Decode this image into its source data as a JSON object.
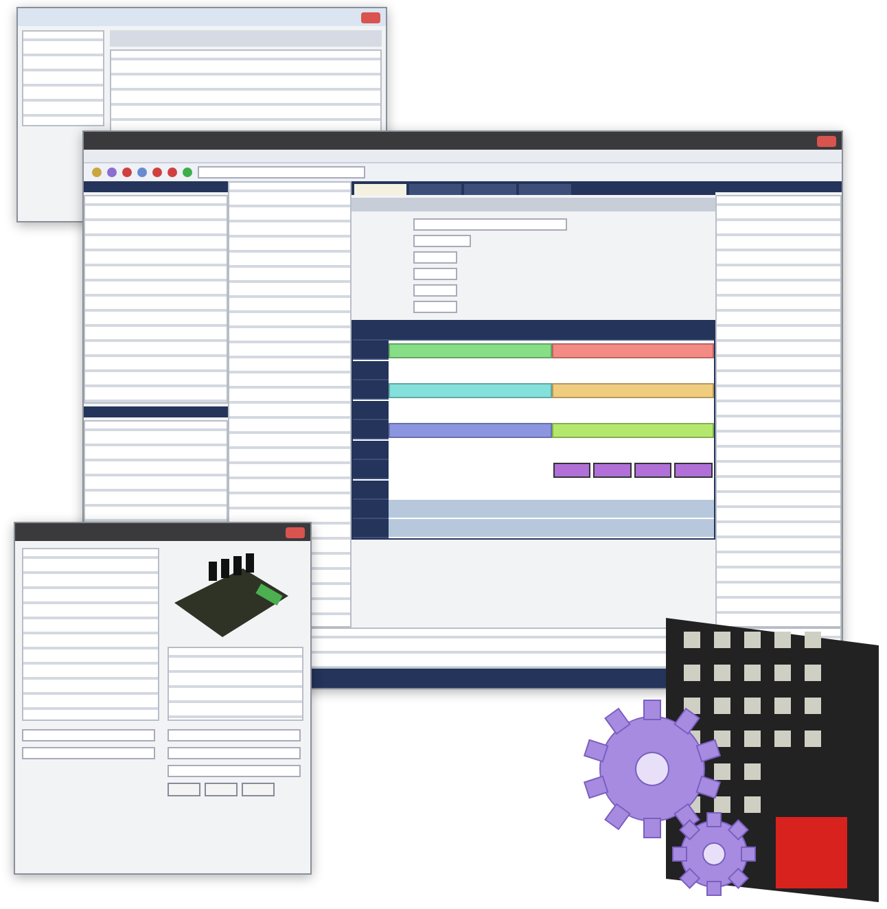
{
  "windows": [
    {
      "kind": "settings"
    },
    {
      "kind": "main"
    },
    {
      "kind": "device-dialog"
    }
  ],
  "main_tabs": [
    {
      "selected": true
    },
    {
      "selected": false
    },
    {
      "selected": false
    },
    {
      "selected": false
    }
  ],
  "schedule": {
    "rows": [
      {
        "kind": "bars",
        "segments": [
          {
            "kind": "bar",
            "color": "#86de86"
          },
          {
            "kind": "bar",
            "color": "#f48a84"
          }
        ]
      },
      {
        "kind": "empty"
      },
      {
        "kind": "bars",
        "segments": [
          {
            "kind": "bar",
            "color": "#84e0da"
          },
          {
            "kind": "bar",
            "color": "#f0cc7e"
          }
        ]
      },
      {
        "kind": "empty"
      },
      {
        "kind": "bars",
        "segments": [
          {
            "kind": "bar",
            "color": "#8c96e0"
          },
          {
            "kind": "bar",
            "color": "#b4e86c"
          }
        ]
      },
      {
        "kind": "empty"
      },
      {
        "kind": "bars",
        "segments": [
          {
            "kind": "empty"
          },
          {
            "kind": "cells",
            "color": "#b070d8"
          }
        ]
      },
      {
        "kind": "empty"
      },
      {
        "kind": "shaded",
        "color": "#b8c8dc"
      },
      {
        "kind": "shaded",
        "color": "#b8c8dc"
      }
    ]
  }
}
